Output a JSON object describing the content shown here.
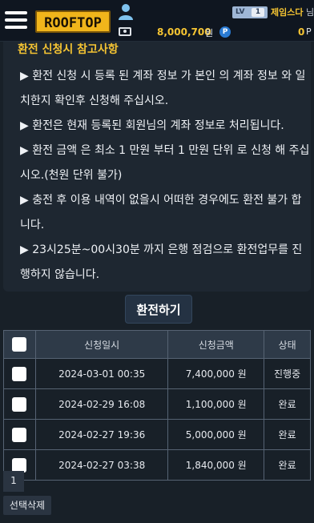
{
  "header": {
    "logo_text": "ROOFTOP",
    "level_label": "LV",
    "level_value": "1",
    "username": "제임스다",
    "username_suffix": "님",
    "balance": "8,000,700",
    "balance_unit": "원",
    "point_symbol": "P",
    "points": "0",
    "points_unit": "P",
    "icons": [
      "menu-icon",
      "user-icon",
      "wallet-icon",
      "point-icon"
    ]
  },
  "notice": {
    "title": "환전 신청시 참고사항",
    "lines": [
      "▶ 환전 신청 시 등록 된 계좌 정보 가 본인 의 계좌 정보 와 일치한지 확인후 신청해 주십시오.",
      "▶ 환전은 현재 등록된 회원님의 계좌 정보로 처리됩니다.",
      "▶ 환전 금액 은 최소 1 만원 부터 1 만원 단위 로 신청 해 주십시오.(천원 단위 불가)",
      "▶ 충전 후 이용 내역이 없을시 어떠한 경우에도 환전 불가 합니다.",
      "▶ 23시25분~00시30분 까지 은행 점검으로 환전업무를 진행하지 않습니다."
    ]
  },
  "withdraw_button": "환전하기",
  "table": {
    "headers": [
      "신청일시",
      "신청금액",
      "상태"
    ],
    "rows": [
      {
        "date": "2024-03-01 00:35",
        "amount": "7,400,000 원",
        "status": "진행중"
      },
      {
        "date": "2024-02-29 16:08",
        "amount": "1,100,000 원",
        "status": "완료"
      },
      {
        "date": "2024-02-27 19:36",
        "amount": "5,000,000 원",
        "status": "완료"
      },
      {
        "date": "2024-02-27 03:38",
        "amount": "1,840,000 원",
        "status": "완료"
      }
    ]
  },
  "pagination": {
    "current": "1"
  },
  "delete_selected_button": "선택삭제",
  "colors": {
    "accent": "#f5c432",
    "background": "#182028",
    "header_bg": "#0f1620",
    "table_header_bg": "#2e3a48"
  }
}
